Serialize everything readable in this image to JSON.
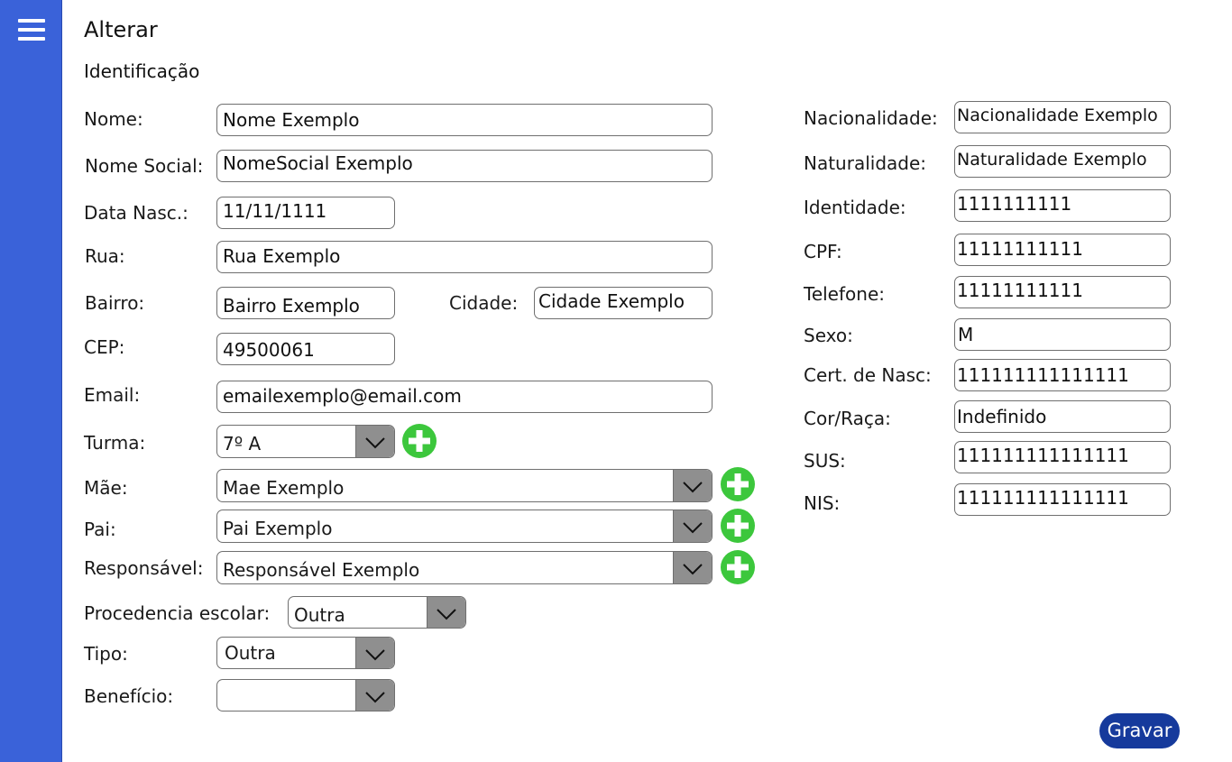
{
  "sidebar": {
    "menu_icon": "hamburger-menu-icon"
  },
  "header": {
    "title": "Alterar",
    "section": "Identificação"
  },
  "colors": {
    "sidebar": "#3a62d9",
    "primary_button": "#163a9c",
    "add_icon": "#3cc73c",
    "dropdown_button": "#8f8f8f"
  },
  "form": {
    "nome": {
      "label": "Nome:",
      "value": "Nome Exemplo"
    },
    "nome_social": {
      "label": "Nome Social:",
      "value": "NomeSocial Exemplo"
    },
    "data_nasc": {
      "label": "Data Nasc.:",
      "value": "11/11/1111"
    },
    "rua": {
      "label": "Rua:",
      "value": "Rua Exemplo"
    },
    "bairro": {
      "label": "Bairro:",
      "value": "Bairro Exemplo"
    },
    "cidade": {
      "label": "Cidade:",
      "value": "Cidade Exemplo"
    },
    "cep": {
      "label": "CEP:",
      "value": "49500061"
    },
    "email": {
      "label": "Email:",
      "value": "emailexemplo@email.com"
    },
    "turma": {
      "label": "Turma:",
      "value": "7º A"
    },
    "mae": {
      "label": "Mãe:",
      "value": "Mae Exemplo"
    },
    "pai": {
      "label": "Pai:",
      "value": "Pai Exemplo"
    },
    "responsavel": {
      "label": "Responsável:",
      "value": "Responsável Exemplo"
    },
    "procedencia": {
      "label": "Procedencia escolar:",
      "value": "Outra"
    },
    "tipo": {
      "label": "Tipo:",
      "value": "Outra"
    },
    "beneficio": {
      "label": "Benefício:",
      "value": ""
    },
    "nacionalidade": {
      "label": "Nacionalidade:",
      "value": "Nacionalidade Exemplo"
    },
    "naturalidade": {
      "label": "Naturalidade:",
      "value": "Naturalidade Exemplo"
    },
    "identidade": {
      "label": "Identidade:",
      "value": "1111111111"
    },
    "cpf": {
      "label": "CPF:",
      "value": "11111111111"
    },
    "telefone": {
      "label": "Telefone:",
      "value": "11111111111"
    },
    "sexo": {
      "label": "Sexo:",
      "value": "M"
    },
    "cert_nasc": {
      "label": "Cert. de Nasc:",
      "value": "111111111111111"
    },
    "cor_raca": {
      "label": "Cor/Raça:",
      "value": "Indefinido"
    },
    "sus": {
      "label": "SUS:",
      "value": "111111111111111"
    },
    "nis": {
      "label": "NIS:",
      "value": "111111111111111"
    }
  },
  "actions": {
    "save_label": "Gravar"
  }
}
